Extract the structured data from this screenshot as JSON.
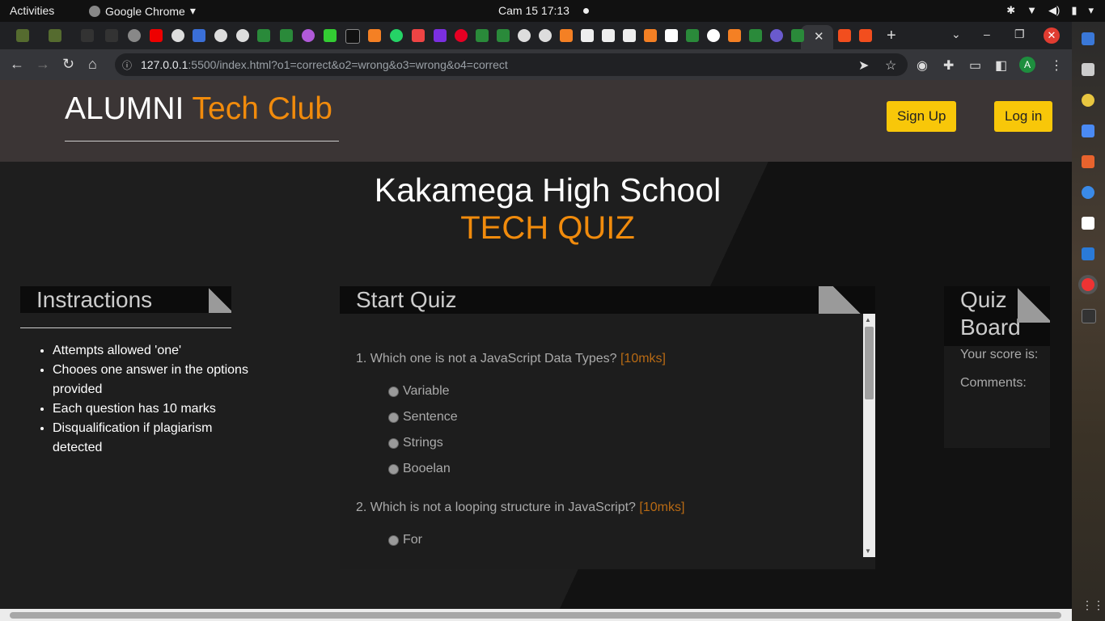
{
  "system": {
    "activities": "Activities",
    "app_name": "Google Chrome",
    "clock": "Cam 15  17:13"
  },
  "browser": {
    "url_host": "127.0.0.1",
    "url_rest": ":5500/index.html?o1=correct&o2=wrong&o3=wrong&o4=correct",
    "avatar_letter": "A"
  },
  "site": {
    "brand_main": "ALUMNI ",
    "brand_accent": "Tech Club",
    "signup_label": "Sign Up",
    "login_label": "Log in",
    "school_name": "Kakamega High School",
    "quiz_title": "TECH QUIZ"
  },
  "instructions": {
    "title": "Instractions",
    "items": [
      "Attempts allowed 'one'",
      "Chooes one answer in the options provided",
      "Each question has 10 marks",
      "Disqualification if plagiarism detected"
    ]
  },
  "quiz": {
    "title": "Start Quiz",
    "questions": [
      {
        "text": "1. Which one is not a JavaScript Data Types? ",
        "marks": "[10mks]",
        "options": [
          "Variable",
          "Sentence",
          "Strings",
          "Booelan"
        ]
      },
      {
        "text": "2. Which is not a looping structure in JavaScript? ",
        "marks": "[10mks]",
        "options": [
          "For"
        ]
      }
    ]
  },
  "board": {
    "title_line1": "Quiz",
    "title_line2": "Board",
    "score_label": "Your score is:",
    "comments_label": "Comments:"
  },
  "colors": {
    "accent": "#f18b0c",
    "button": "#f8c709",
    "header_bg": "#3b3535"
  }
}
